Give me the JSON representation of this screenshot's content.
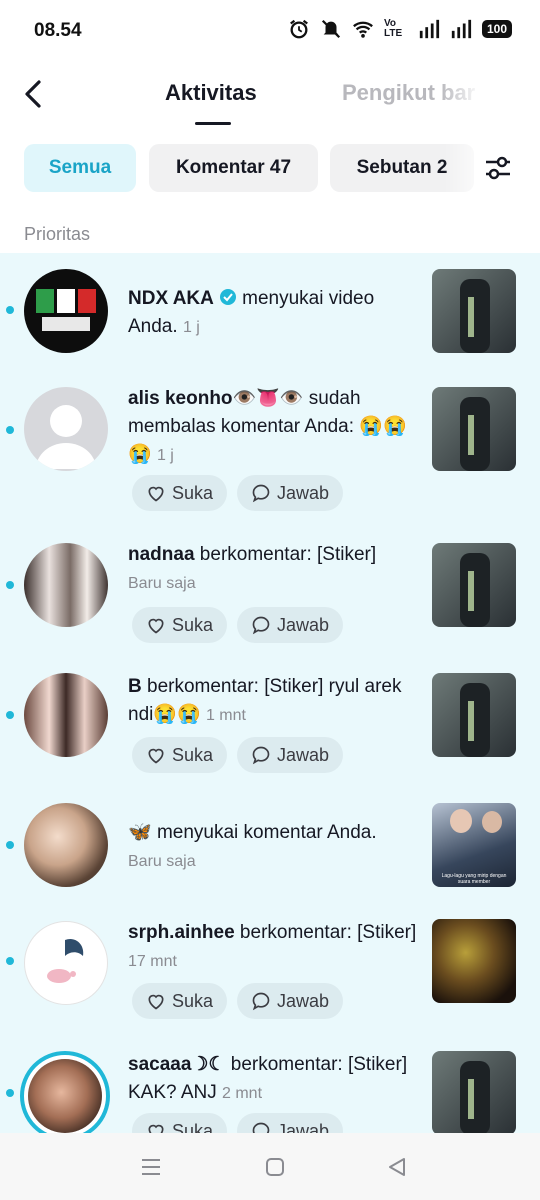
{
  "status": {
    "time": "08.54",
    "battery": "100",
    "network": "Vo LTE"
  },
  "header": {
    "tab_active": "Aktivitas",
    "tab_inactive": "Pengikut bar"
  },
  "filters": {
    "all": "Semua",
    "comments": "Komentar 47",
    "mentions": "Sebutan 2"
  },
  "section": {
    "title": "Prioritas"
  },
  "actions": {
    "like": "Suka",
    "reply": "Jawab"
  },
  "items": [
    {
      "user": "NDX AKA",
      "action": " menyukai video Anda.",
      "time": "1 j"
    },
    {
      "user": "alis keonho👁️👅👁️",
      "action": " sudah membalas komentar Anda: 😭😭😭",
      "time": "1 j"
    },
    {
      "user": "nadnaa",
      "action": " berkomentar: [Stiker]",
      "time": "Baru saja"
    },
    {
      "user": "B",
      "action": " berkomentar: [Stiker] ryul arek ndi😭😭",
      "time": "1 mnt"
    },
    {
      "user": "🦋",
      "action": " menyukai komentar Anda.",
      "time": "Baru saja",
      "thumb_caption": "Lagu-lagu yang mirip dengan suara member"
    },
    {
      "user": "srph.ainhee",
      "action": " berkomentar: [Stiker]",
      "time": "17 mnt"
    },
    {
      "user": "sacaaa☽☾",
      "action": " berkomentar: [Stiker] KAK? ANJ",
      "time": "2 mnt"
    }
  ],
  "colors": {
    "accent": "#20b8d8",
    "list_bg": "#eaf9fc",
    "chip_active_bg": "#e0f6fb"
  },
  "icons": [
    "back-arrow-icon",
    "filter-sliders-icon",
    "verified-icon",
    "heart-icon",
    "comment-icon",
    "menu-icon",
    "home-icon",
    "back-icon"
  ]
}
